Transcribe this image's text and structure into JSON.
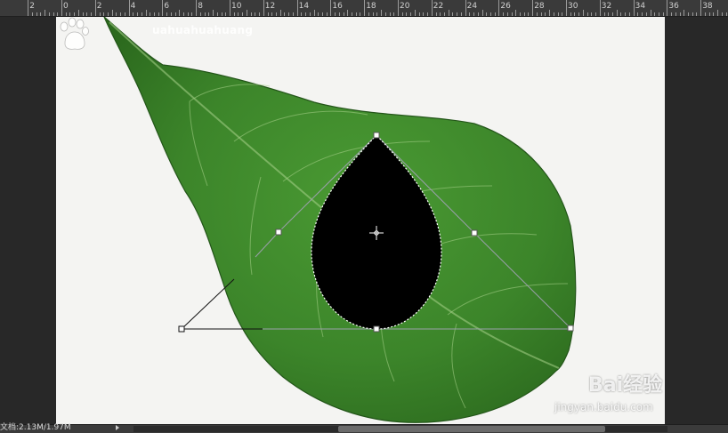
{
  "ruler": {
    "labels": [
      "2",
      "0",
      "2",
      "4",
      "6",
      "8",
      "10",
      "12",
      "14",
      "16",
      "18",
      "20",
      "22",
      "24",
      "26",
      "28",
      "30",
      "32",
      "34",
      "36",
      "38"
    ]
  },
  "canvas": {
    "background_color": "#f4f4f2",
    "leaf_color": "#3f8a2a",
    "shape_fill": "#000000",
    "watermark_text": "uahuahuahuang",
    "baidu_brand": "Bai经验",
    "baidu_url": "jingyan.baidu.com"
  },
  "status": {
    "doc_info": "文档:2.13M/1.97M"
  },
  "icons": {
    "center": "crosshair-icon",
    "anchor": "anchor-point-icon",
    "handle": "bezier-handle-icon",
    "paw": "paw-logo-icon"
  }
}
